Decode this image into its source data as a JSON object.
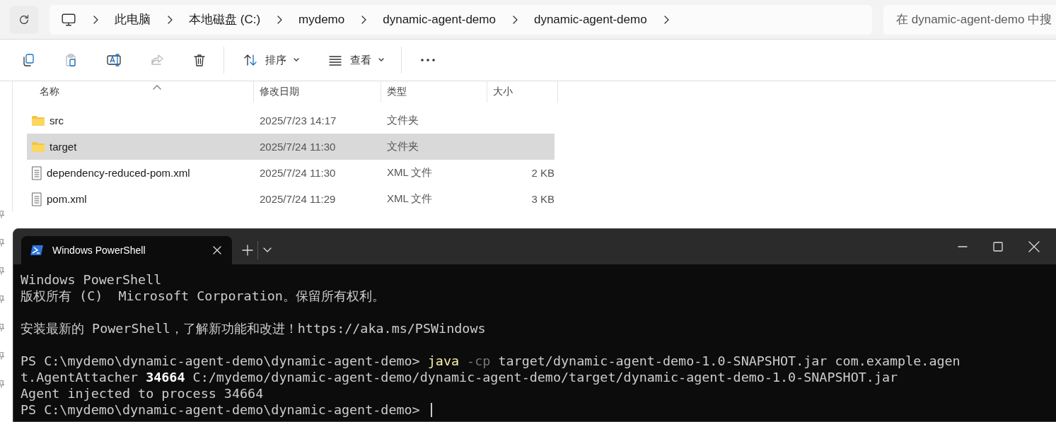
{
  "explorer": {
    "breadcrumb": [
      "此电脑",
      "本地磁盘 (C:)",
      "mydemo",
      "dynamic-agent-demo",
      "dynamic-agent-demo"
    ],
    "search": {
      "placeholder": "在 dynamic-agent-demo 中搜"
    },
    "toolbar": [
      {
        "kind": "copy",
        "disabled": false
      },
      {
        "kind": "paste",
        "disabled": true
      },
      {
        "kind": "rename",
        "disabled": false
      },
      {
        "kind": "share",
        "disabled": true
      },
      {
        "kind": "delete",
        "disabled": false
      },
      {
        "kind": "sort",
        "label": "排序",
        "disabled": false
      },
      {
        "kind": "view",
        "label": "查看",
        "disabled": false
      },
      {
        "kind": "more",
        "disabled": false
      }
    ],
    "columns": [
      "名称",
      "修改日期",
      "类型",
      "大小"
    ],
    "files": [
      {
        "kind": "folder",
        "name": "src",
        "modified": "2025/7/23 14:17",
        "type": "文件夹",
        "selected": false
      },
      {
        "kind": "folder",
        "name": "target",
        "modified": "2025/7/24 11:30",
        "type": "文件夹",
        "selected": true
      },
      {
        "kind": "file",
        "name": "dependency-reduced-pom.xml",
        "modified": "2025/7/24 11:30",
        "type": "XML 文件",
        "size": "2 KB",
        "selected": false
      },
      {
        "kind": "file",
        "name": "pom.xml",
        "modified": "2025/7/24 11:29",
        "type": "XML 文件",
        "size": "3 KB",
        "selected": false
      }
    ]
  },
  "terminal": {
    "tab": {
      "title": "Windows PowerShell"
    },
    "blocks": [
      [
        [
          {
            "kind": "out",
            "text": "Windows PowerShell"
          }
        ],
        [
          {
            "kind": "out",
            "text": "版权所有 (C)  Microsoft Corporation。保留所有权利。"
          }
        ]
      ],
      [
        [
          {
            "kind": "out",
            "text": "安装最新的 PowerShell，了解新功能和改进！https://aka.ms/PSWindows"
          }
        ]
      ],
      [
        [
          {
            "kind": "out",
            "text": "PS C:\\mydemo\\dynamic-agent-demo\\dynamic-agent-demo> "
          },
          {
            "kind": "command",
            "text": "java"
          },
          {
            "kind": "param",
            "text": " -cp"
          },
          {
            "kind": "out",
            "text": " target/dynamic-agent-demo-1.0-SNAPSHOT.jar com.example.agen"
          }
        ],
        [
          {
            "kind": "out",
            "text": "t.AgentAttacher "
          },
          {
            "kind": "number",
            "text": "34664"
          },
          {
            "kind": "out",
            "text": " C:/mydemo/dynamic-agent-demo/dynamic-agent-demo/target/dynamic-agent-demo-1.0-SNAPSHOT.jar"
          }
        ],
        [
          {
            "kind": "out",
            "text": "Agent injected to process 34664"
          }
        ],
        [
          {
            "kind": "out",
            "text": "PS C:\\mydemo\\dynamic-agent-demo\\dynamic-agent-demo> "
          },
          {
            "kind": "cursor"
          }
        ]
      ]
    ]
  }
}
